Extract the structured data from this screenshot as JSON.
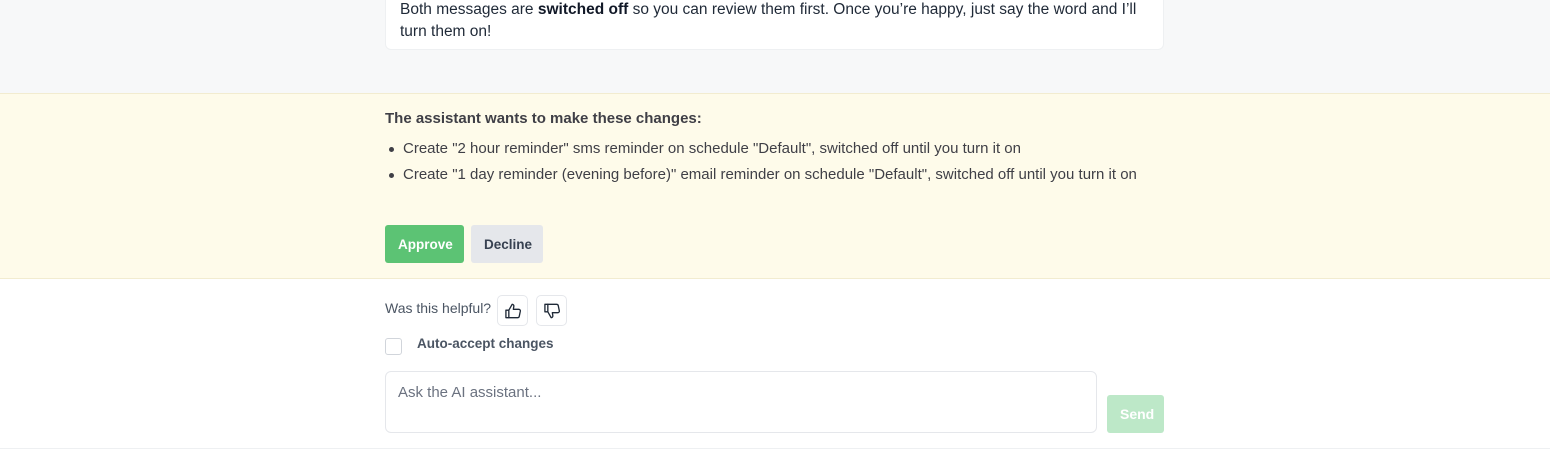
{
  "message": {
    "text_before": "Both messages are ",
    "text_bold": "switched off",
    "text_after": " so you can review them first. Once you’re happy, just say the word and I’ll turn them on!"
  },
  "approval": {
    "title": "The assistant wants to make these changes:",
    "changes": [
      "Create \"2 hour reminder\" sms reminder on schedule \"Default\", switched off until you turn it on",
      "Create \"1 day reminder (evening before)\" email reminder on schedule \"Default\", switched off until you turn it on"
    ],
    "approve_label": "Approve",
    "decline_label": "Decline"
  },
  "feedback": {
    "label": "Was this helpful?",
    "thumbs_up_icon": "thumbs-up-icon",
    "thumbs_down_icon": "thumbs-down-icon"
  },
  "auto_accept": {
    "label": "Auto-accept changes",
    "checked": false
  },
  "chat": {
    "placeholder": "Ask the AI assistant...",
    "value": "",
    "send_label": "Send"
  },
  "colors": {
    "approve": "#5cc374",
    "send_disabled": "#bde8c8",
    "approval_background": "#fefbea",
    "message_area_background": "#f7f8f9"
  }
}
